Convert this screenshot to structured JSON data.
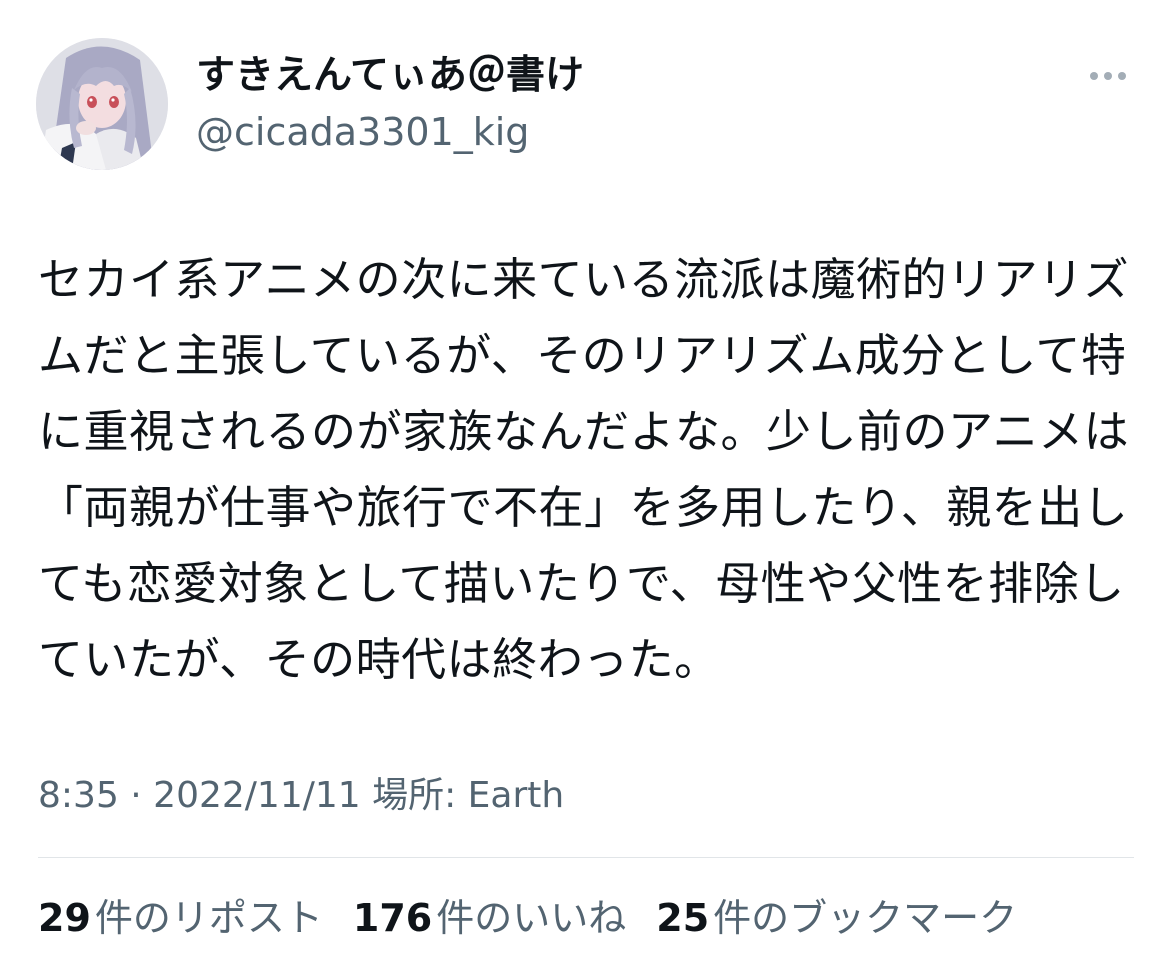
{
  "author": {
    "display_name": "すきえんてぃあ＠書け",
    "handle": "@cicada3301_kig",
    "avatar_icon": "profile-avatar"
  },
  "more_icon": "ellipsis-icon",
  "tweet": {
    "text": "セカイ系アニメの次に来ている流派は魔術的リアリズムだと主張しているが、そのリアリズム成分として特に重視されるのが家族なんだよな。少し前のアニメは「両親が仕事や旅行で不在」を多用したり、親を出しても恋愛対象として描いたりで、母性や父性を排除していたが、その時代は終わった。",
    "meta": "8:35 · 2022/11/11 場所: Earth"
  },
  "stats": {
    "reposts": {
      "count": "29",
      "label": "件のリポスト"
    },
    "likes": {
      "count": "176",
      "label": "件のいいね"
    },
    "bookmarks": {
      "count": "25",
      "label": "件のブックマーク"
    }
  },
  "colors": {
    "text_primary": "#0f1419",
    "text_secondary": "#536471",
    "divider": "#e1e5e8"
  }
}
